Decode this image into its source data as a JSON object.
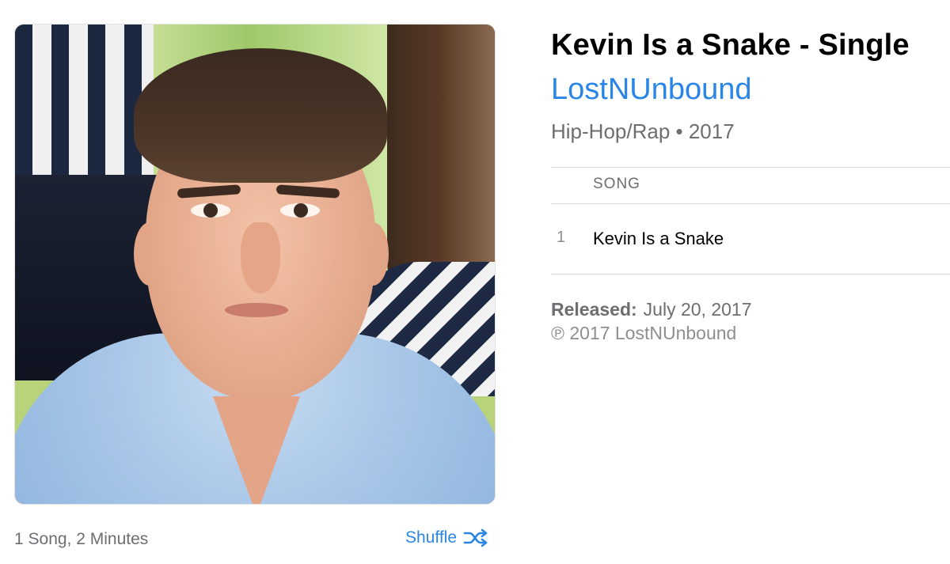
{
  "album": {
    "title": "Kevin Is a Snake - Single",
    "artist": "LostNUnbound",
    "genre_year": "Hip-Hop/Rap • 2017",
    "artwork_icon": "album-artwork"
  },
  "tracklist": {
    "column_header": "SONG",
    "tracks": [
      {
        "number": "1",
        "name": "Kevin Is a Snake"
      }
    ]
  },
  "release": {
    "released_label": "Released:",
    "released_date": "July 20, 2017",
    "copyright": "℗ 2017 LostNUnbound"
  },
  "footer": {
    "song_count": "1 Song, 2 Minutes",
    "shuffle_label": "Shuffle",
    "shuffle_icon": "shuffle-icon"
  },
  "colors": {
    "accent": "#2a86e6",
    "secondary_text": "#6d6d72",
    "divider": "#d8d8dc"
  }
}
